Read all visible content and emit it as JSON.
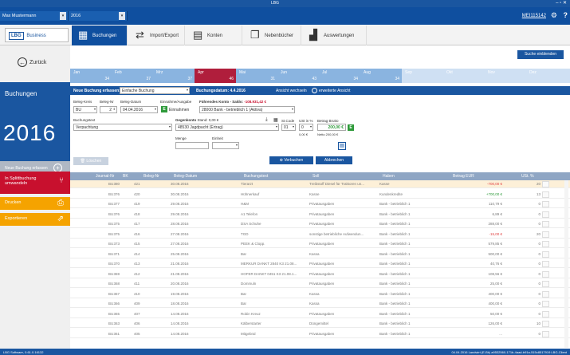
{
  "window": {
    "title": "LBG",
    "controls": "– ▫ ✕"
  },
  "topbar": {
    "user": "Max Mustermann",
    "year": "2016",
    "user_link": "MEI115142",
    "help": "?"
  },
  "app": {
    "logo_box": "LBG",
    "logo_text": "Business"
  },
  "tabs": [
    {
      "label": "Buchungen"
    },
    {
      "label": "Import/Export"
    },
    {
      "label": "Konten"
    },
    {
      "label": "Nebenbücher"
    },
    {
      "label": "Auswertungen"
    }
  ],
  "sidebar": {
    "back": "Zurück",
    "section": "Buchungen",
    "year": "2016",
    "new_booking": "Neue Buchung erfassen",
    "split": "In Splittbuchung umwandeln",
    "print": "Drucken",
    "export": "Exportieren"
  },
  "search_button": "Suche einblenden",
  "months": [
    {
      "name": "Jan",
      "count": "34"
    },
    {
      "name": "Feb",
      "count": "37"
    },
    {
      "name": "Mrz",
      "count": "37"
    },
    {
      "name": "Apr",
      "count": "46"
    },
    {
      "name": "Mai",
      "count": "31"
    },
    {
      "name": "Jun",
      "count": "43"
    },
    {
      "name": "Jul",
      "count": "34"
    },
    {
      "name": "Aug",
      "count": "34"
    },
    {
      "name": "Sep",
      "count": ""
    },
    {
      "name": "Okt",
      "count": ""
    },
    {
      "name": "Nov",
      "count": ""
    },
    {
      "name": "Dez",
      "count": ""
    }
  ],
  "form": {
    "new_label": "Neue Buchung erfassen:",
    "type": "Einfache Buchung",
    "date_label": "Buchungsdatum: 4.4.2016",
    "view_simple": "Ansicht wechseln",
    "view_extended": "erweiterte Ansicht",
    "lbl_kreis": "Beleg-Kreis",
    "kreis": "BU",
    "lbl_nr": "Beleg-Nr",
    "nr": "2",
    "lbl_datum": "Beleg-Datum",
    "datum": "04.04.2016",
    "lbl_einaus": "Einnahme/Ausgabe",
    "einaus_icon": "E",
    "einaus": "Einnahmen",
    "lbl_konto": "Führendes Konto - Saldo: ",
    "konto_saldo": "-108.931,42 €",
    "konto": "28000 Bank - betrieblich 1 (Aktiva)",
    "lbl_zweck": "Buchungstext",
    "zweck": "Verpachtung",
    "lbl_gegen": "Gegenkonto",
    "gegen_stand": " Stand: 0,00 €",
    "gegen": "48530 Jagdpacht (Ertrag)",
    "lbl_stcode": "St.Code",
    "stcode": "01",
    "lbl_ust": "USt in %",
    "ust": "0",
    "ust_val": "0,00 €",
    "lbl_betrag": "Betrag Brutto",
    "betrag": "200,00 €",
    "betrag_icon": "E",
    "netto": "Netto 200,00 €",
    "lbl_menge": "Menge",
    "lbl_einheit": "Einheit",
    "delete": "Löschen",
    "book": "Verbuchen",
    "cancel": "Abbrechen"
  },
  "grid": {
    "headers": [
      "Journal-Nr",
      "BK",
      "Beleg-Nr",
      "Beleg-Datum",
      "Buchungstext",
      "Soll",
      "Haben",
      "Betrag EUR",
      "USt. %"
    ],
    "rows": [
      [
        "380",
        "BU",
        "421",
        "30.08.2016",
        "Tierarzt",
        "Treibstoff Diesel für Traktoren un...",
        "Kasse",
        "-700,00 €",
        "20"
      ],
      [
        "376",
        "BU",
        "420",
        "30.08.2016",
        "Hühnerkauf",
        "Kasse",
        "Kundenkredite",
        "+700,00 €",
        "13"
      ],
      [
        "377",
        "BU",
        "419",
        "29.08.2016",
        "H&M",
        "Privatausgaben",
        "Bank - betrieblich 1",
        "110,79 €",
        "0"
      ],
      [
        "376",
        "BU",
        "418",
        "29.08.2016",
        "A1 Telefon",
        "Privatausgaben",
        "Bank - betrieblich 1",
        "6,89 €",
        "0"
      ],
      [
        "375",
        "BU",
        "417",
        "28.08.2016",
        "DSA Schuhe",
        "Privatausgaben",
        "Bank - betrieblich 1",
        "288,00 €",
        "0"
      ],
      [
        "375",
        "BU",
        "416",
        "27.08.2016",
        "TGD",
        "sonstige betriebliche Aufwendun...",
        "Bank - betrieblich 1",
        "-15,00 €",
        "20"
      ],
      [
        "373",
        "BU",
        "415",
        "27.08.2016",
        "PEEK & Clopp.",
        "Privatausgaben",
        "Bank - betrieblich 1",
        "579,85 €",
        "0"
      ],
      [
        "371",
        "BU",
        "414",
        "25.08.2016",
        "Bar",
        "Kassa",
        "Bank - betrieblich 1",
        "500,00 €",
        "0"
      ],
      [
        "370",
        "BU",
        "413",
        "21.08.2016",
        "MERKUR DANKT 2840 K3 21.08...",
        "Privatausgaben",
        "Bank - betrieblich 1",
        "40,76 €",
        "0"
      ],
      [
        "369",
        "BU",
        "412",
        "21.08.2016",
        "HOFER DANKT 0451 K3 21.08.1...",
        "Privatausgaben",
        "Bank - betrieblich 1",
        "108,56 €",
        "0"
      ],
      [
        "368",
        "BU",
        "411",
        "20.08.2016",
        "Dommuln",
        "Privatausgaben",
        "Bank - betrieblich 1",
        "25,00 €",
        "0"
      ],
      [
        "367",
        "BU",
        "410",
        "19.08.2016",
        "Bar",
        "Kassa",
        "Bank - betrieblich 1",
        "400,00 €",
        "0"
      ],
      [
        "366",
        "BU",
        "409",
        "18.08.2016",
        "Bar",
        "Kassa",
        "Bank - betrieblich 1",
        "400,00 €",
        "0"
      ],
      [
        "365",
        "BU",
        "407",
        "14.08.2016",
        "Robin Kreuz",
        "Privatausgaben",
        "Bank - betrieblich 1",
        "50,00 €",
        "0"
      ],
      [
        "363",
        "BU",
        "406",
        "14.08.2016",
        "Kälberstarter",
        "Düngemittel",
        "Bank - betrieblich 1",
        "126,00 €",
        "10"
      ],
      [
        "361",
        "BU",
        "405",
        "14.08.2016",
        "Mitgebral",
        "Privatausgaben",
        "Bank - betrieblich 1",
        "...",
        "0"
      ]
    ]
  },
  "status": {
    "left": "LBG Software, 0.61.0.16132",
    "right": "04.04.2016   Landwirt (E-Bk) a9532560-171b-4aad-b91a-515c8517919  LBG-Client"
  }
}
